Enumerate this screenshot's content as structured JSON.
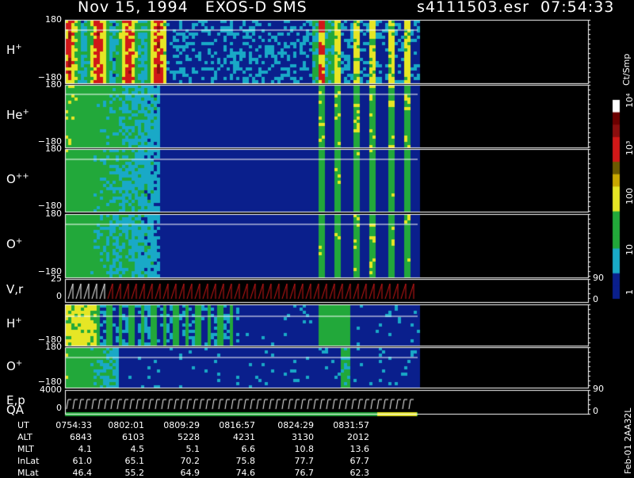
{
  "header": {
    "title": "Nov 15, 1994   EXOS-D SMS",
    "file_info": "s4111503.esr  07:54:33"
  },
  "colors": {
    "background": "#000000",
    "low": "#0a1f8c",
    "cyan": "#19a9c7",
    "green": "#22a83a",
    "yellow": "#e6e625",
    "red": "#d01818",
    "dark_red": "#8b0e0e"
  },
  "chart_data": {
    "type": "heatmap",
    "x_time_labels": [
      "0754:33",
      "0802:01",
      "0809:29",
      "0816:57",
      "0824:29",
      "0831:57"
    ],
    "panels": [
      {
        "label": "H",
        "charge": "+",
        "ytick_top": "180",
        "ytick_bottom": "−180"
      },
      {
        "label": "He",
        "charge": "+",
        "ytick_top": "180",
        "ytick_bottom": "−180"
      },
      {
        "label": "O",
        "charge": "++",
        "ytick_top": "180",
        "ytick_bottom": "−180"
      },
      {
        "label": "O",
        "charge": "+",
        "ytick_top": "180",
        "ytick_bottom": "−180"
      },
      {
        "label": "V,r",
        "charge": "",
        "ytick_top": "25",
        "ytick_bottom": "0",
        "right_top": "90",
        "right_bottom": "0"
      },
      {
        "label": "H",
        "charge": "+",
        "ytick_top": "",
        "ytick_bottom": "−180"
      },
      {
        "label": "O",
        "charge": "+",
        "ytick_top": "180",
        "ytick_bottom": "−180"
      },
      {
        "label": "E,p",
        "charge": "",
        "ytick_top": "4000",
        "ytick_bottom": "0",
        "right_top": "90",
        "right_bottom": "0"
      }
    ],
    "qa_label": "QA",
    "colorbar": {
      "label": "Ct/Smp",
      "ticks": [
        "1",
        "10",
        "100",
        "10³",
        "10⁴"
      ]
    },
    "ephemeris": [
      {
        "name": "UT",
        "values": [
          "0754:33",
          "0802:01",
          "0809:29",
          "0816:57",
          "0824:29",
          "0831:57"
        ]
      },
      {
        "name": "ALT",
        "values": [
          "6843",
          "6103",
          "5228",
          "4231",
          "3130",
          "2012"
        ]
      },
      {
        "name": "MLT",
        "values": [
          "4.1",
          "4.5",
          "5.1",
          "6.6",
          "10.8",
          "13.6"
        ]
      },
      {
        "name": "InLat",
        "values": [
          "61.0",
          "65.1",
          "70.2",
          "75.8",
          "77.7",
          "67.7"
        ]
      },
      {
        "name": "MLat",
        "values": [
          "46.4",
          "55.2",
          "64.9",
          "74.6",
          "76.7",
          "62.3"
        ]
      }
    ],
    "footer": "Feb-01 2AA32L"
  }
}
